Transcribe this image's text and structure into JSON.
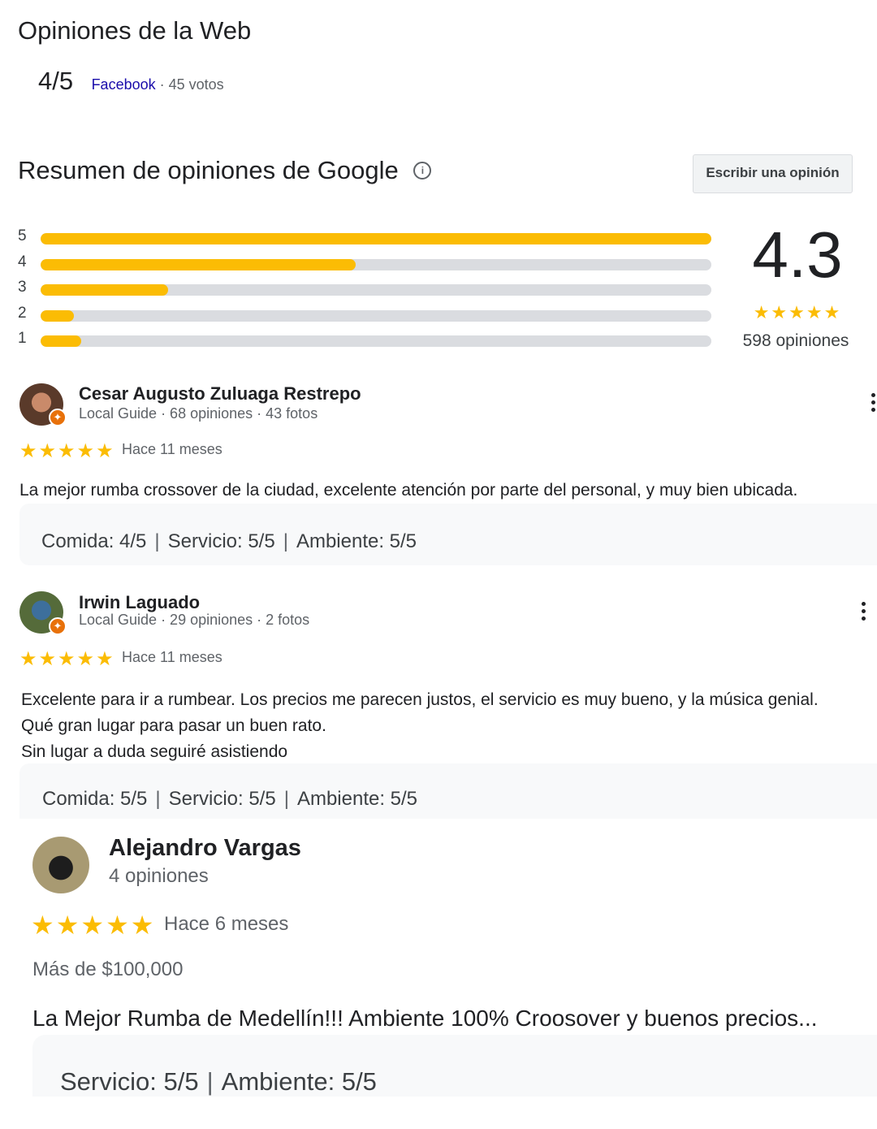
{
  "web": {
    "title": "Opiniones de la Web",
    "score": "4/5",
    "source": "Facebook",
    "votes": " · 45 votos"
  },
  "summary": {
    "title": "Resumen de opiniones de Google",
    "write_button": "Escribir una opinión",
    "score": "4.3",
    "stars": "★★★★★",
    "count": "598 opiniones",
    "bars": [
      {
        "label": "5",
        "fraction": 1.0
      },
      {
        "label": "4",
        "fraction": 0.47
      },
      {
        "label": "3",
        "fraction": 0.19
      },
      {
        "label": "2",
        "fraction": 0.05
      },
      {
        "label": "1",
        "fraction": 0.06
      }
    ]
  },
  "reviews": [
    {
      "name": "Cesar Augusto Zuluaga Restrepo",
      "meta": "Local Guide · 68 opiniones · 43 fotos",
      "stars": "★★★★★",
      "time": "Hace 11 meses",
      "text": "La mejor rumba crossover de la ciudad, excelente atención por parte del personal, y muy bien ubicada.",
      "ratings": {
        "comida": "Comida: 4/5",
        "servicio": "Servicio: 5/5",
        "ambiente": "Ambiente: 5/5"
      }
    },
    {
      "name": "Irwin Laguado",
      "meta": "Local Guide · 29 opiniones · 2 fotos",
      "stars": "★★★★★",
      "time": "Hace 11 meses",
      "text_lines": [
        "Excelente para ir a rumbear. Los precios me parecen justos, el servicio es muy bueno, y la música genial.",
        "Qué gran lugar para pasar un buen rato.",
        "Sin lugar a duda seguiré asistiendo"
      ],
      "ratings": {
        "comida": "Comida: 5/5",
        "servicio": "Servicio: 5/5",
        "ambiente": "Ambiente: 5/5"
      }
    },
    {
      "name": "Alejandro Vargas",
      "meta": "4 opiniones",
      "stars": "★★★★★",
      "time": "Hace 6 meses",
      "price": "Más de $100,000",
      "text": "La Mejor Rumba de Medellín!!! Ambiente 100% Croosover y buenos precios...",
      "ratings": {
        "servicio": "Servicio: 5/5",
        "ambiente": "Ambiente: 5/5"
      }
    }
  ],
  "separator": "|",
  "icons": {
    "info": "info-icon",
    "menu": "more-vert-icon",
    "badge": "local-guide-badge-icon"
  },
  "colors": {
    "star": "#fbbc04",
    "bar_track": "#dadce0",
    "link": "#1a0dab",
    "badge": "#e8710a"
  }
}
